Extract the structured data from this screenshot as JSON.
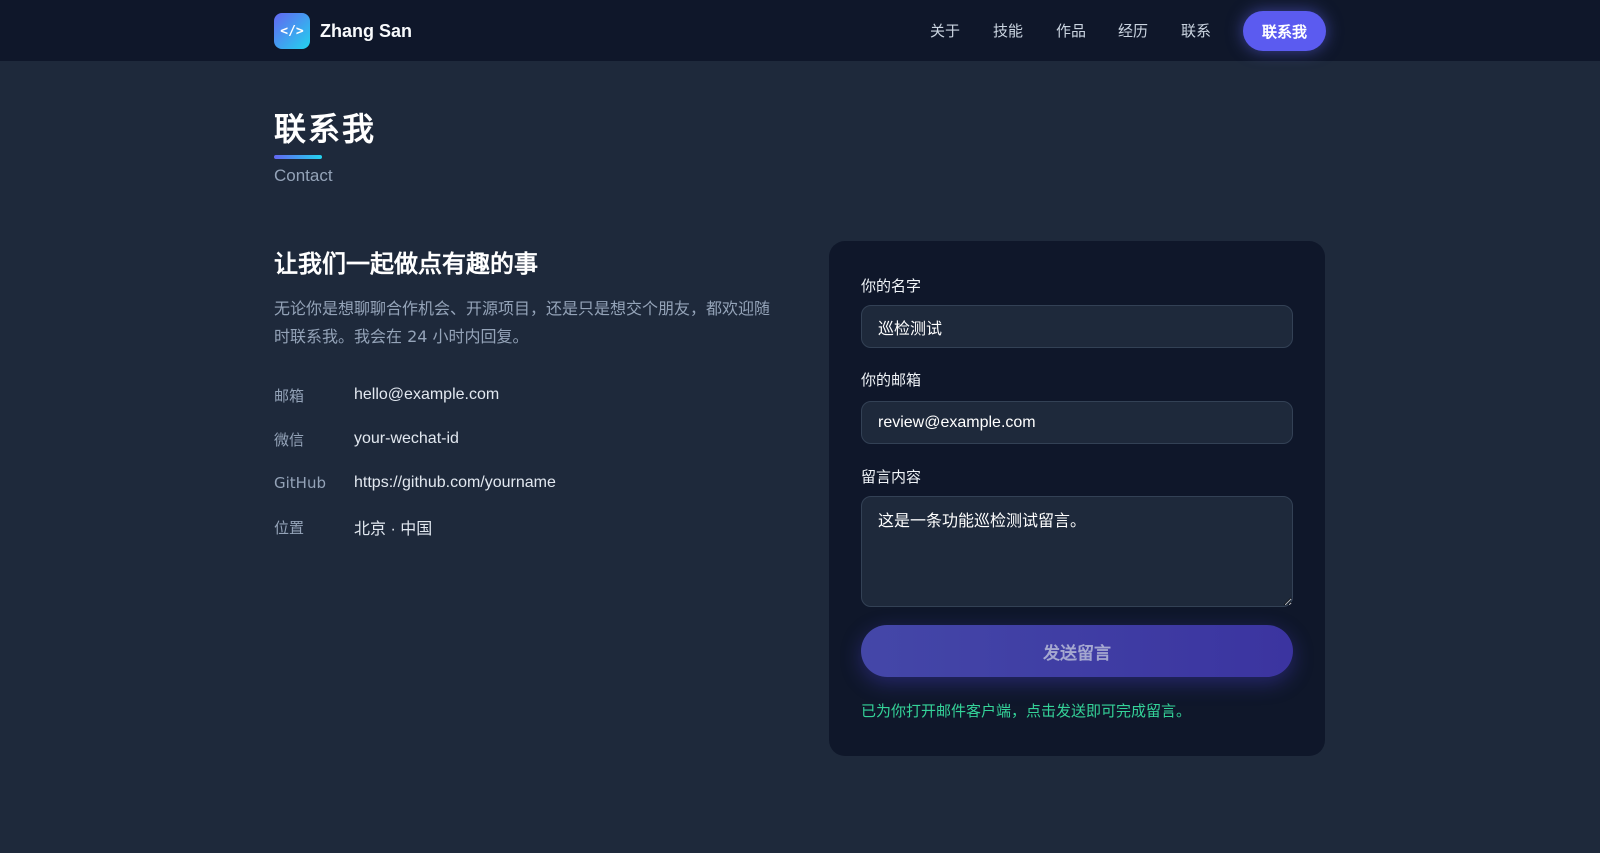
{
  "nav": {
    "logo_glyph": "</>",
    "brand": "Zhang San",
    "links": [
      "关于",
      "技能",
      "作品",
      "经历",
      "联系"
    ],
    "cta": "联系我"
  },
  "section": {
    "title": "联系我",
    "subtitle": "Contact"
  },
  "intro": {
    "heading": "让我们一起做点有趣的事",
    "description": "无论你是想聊聊合作机会、开源项目，还是只是想交个朋友，都欢迎随时联系我。我会在 24 小时内回复。"
  },
  "contact_info": [
    {
      "label": "邮箱",
      "value": "hello@example.com"
    },
    {
      "label": "微信",
      "value": "your-wechat-id"
    },
    {
      "label": "GitHub",
      "value": "https://github.com/yourname"
    },
    {
      "label": "位置",
      "value": "北京 · 中国"
    }
  ],
  "form": {
    "name_label": "你的名字",
    "name_value": "巡检测试",
    "email_label": "你的邮箱",
    "email_value": "review@example.com",
    "message_label": "留言内容",
    "message_value": "这是一条功能巡检测试留言。",
    "submit_label": "发送留言",
    "status": "已为你打开邮件客户端，点击发送即可完成留言。"
  },
  "colors": {
    "background": "#1e293b",
    "navbar": "#0f172a",
    "accent": "#6366f1",
    "accent_secondary": "#22d3ee",
    "success": "#34d399"
  }
}
